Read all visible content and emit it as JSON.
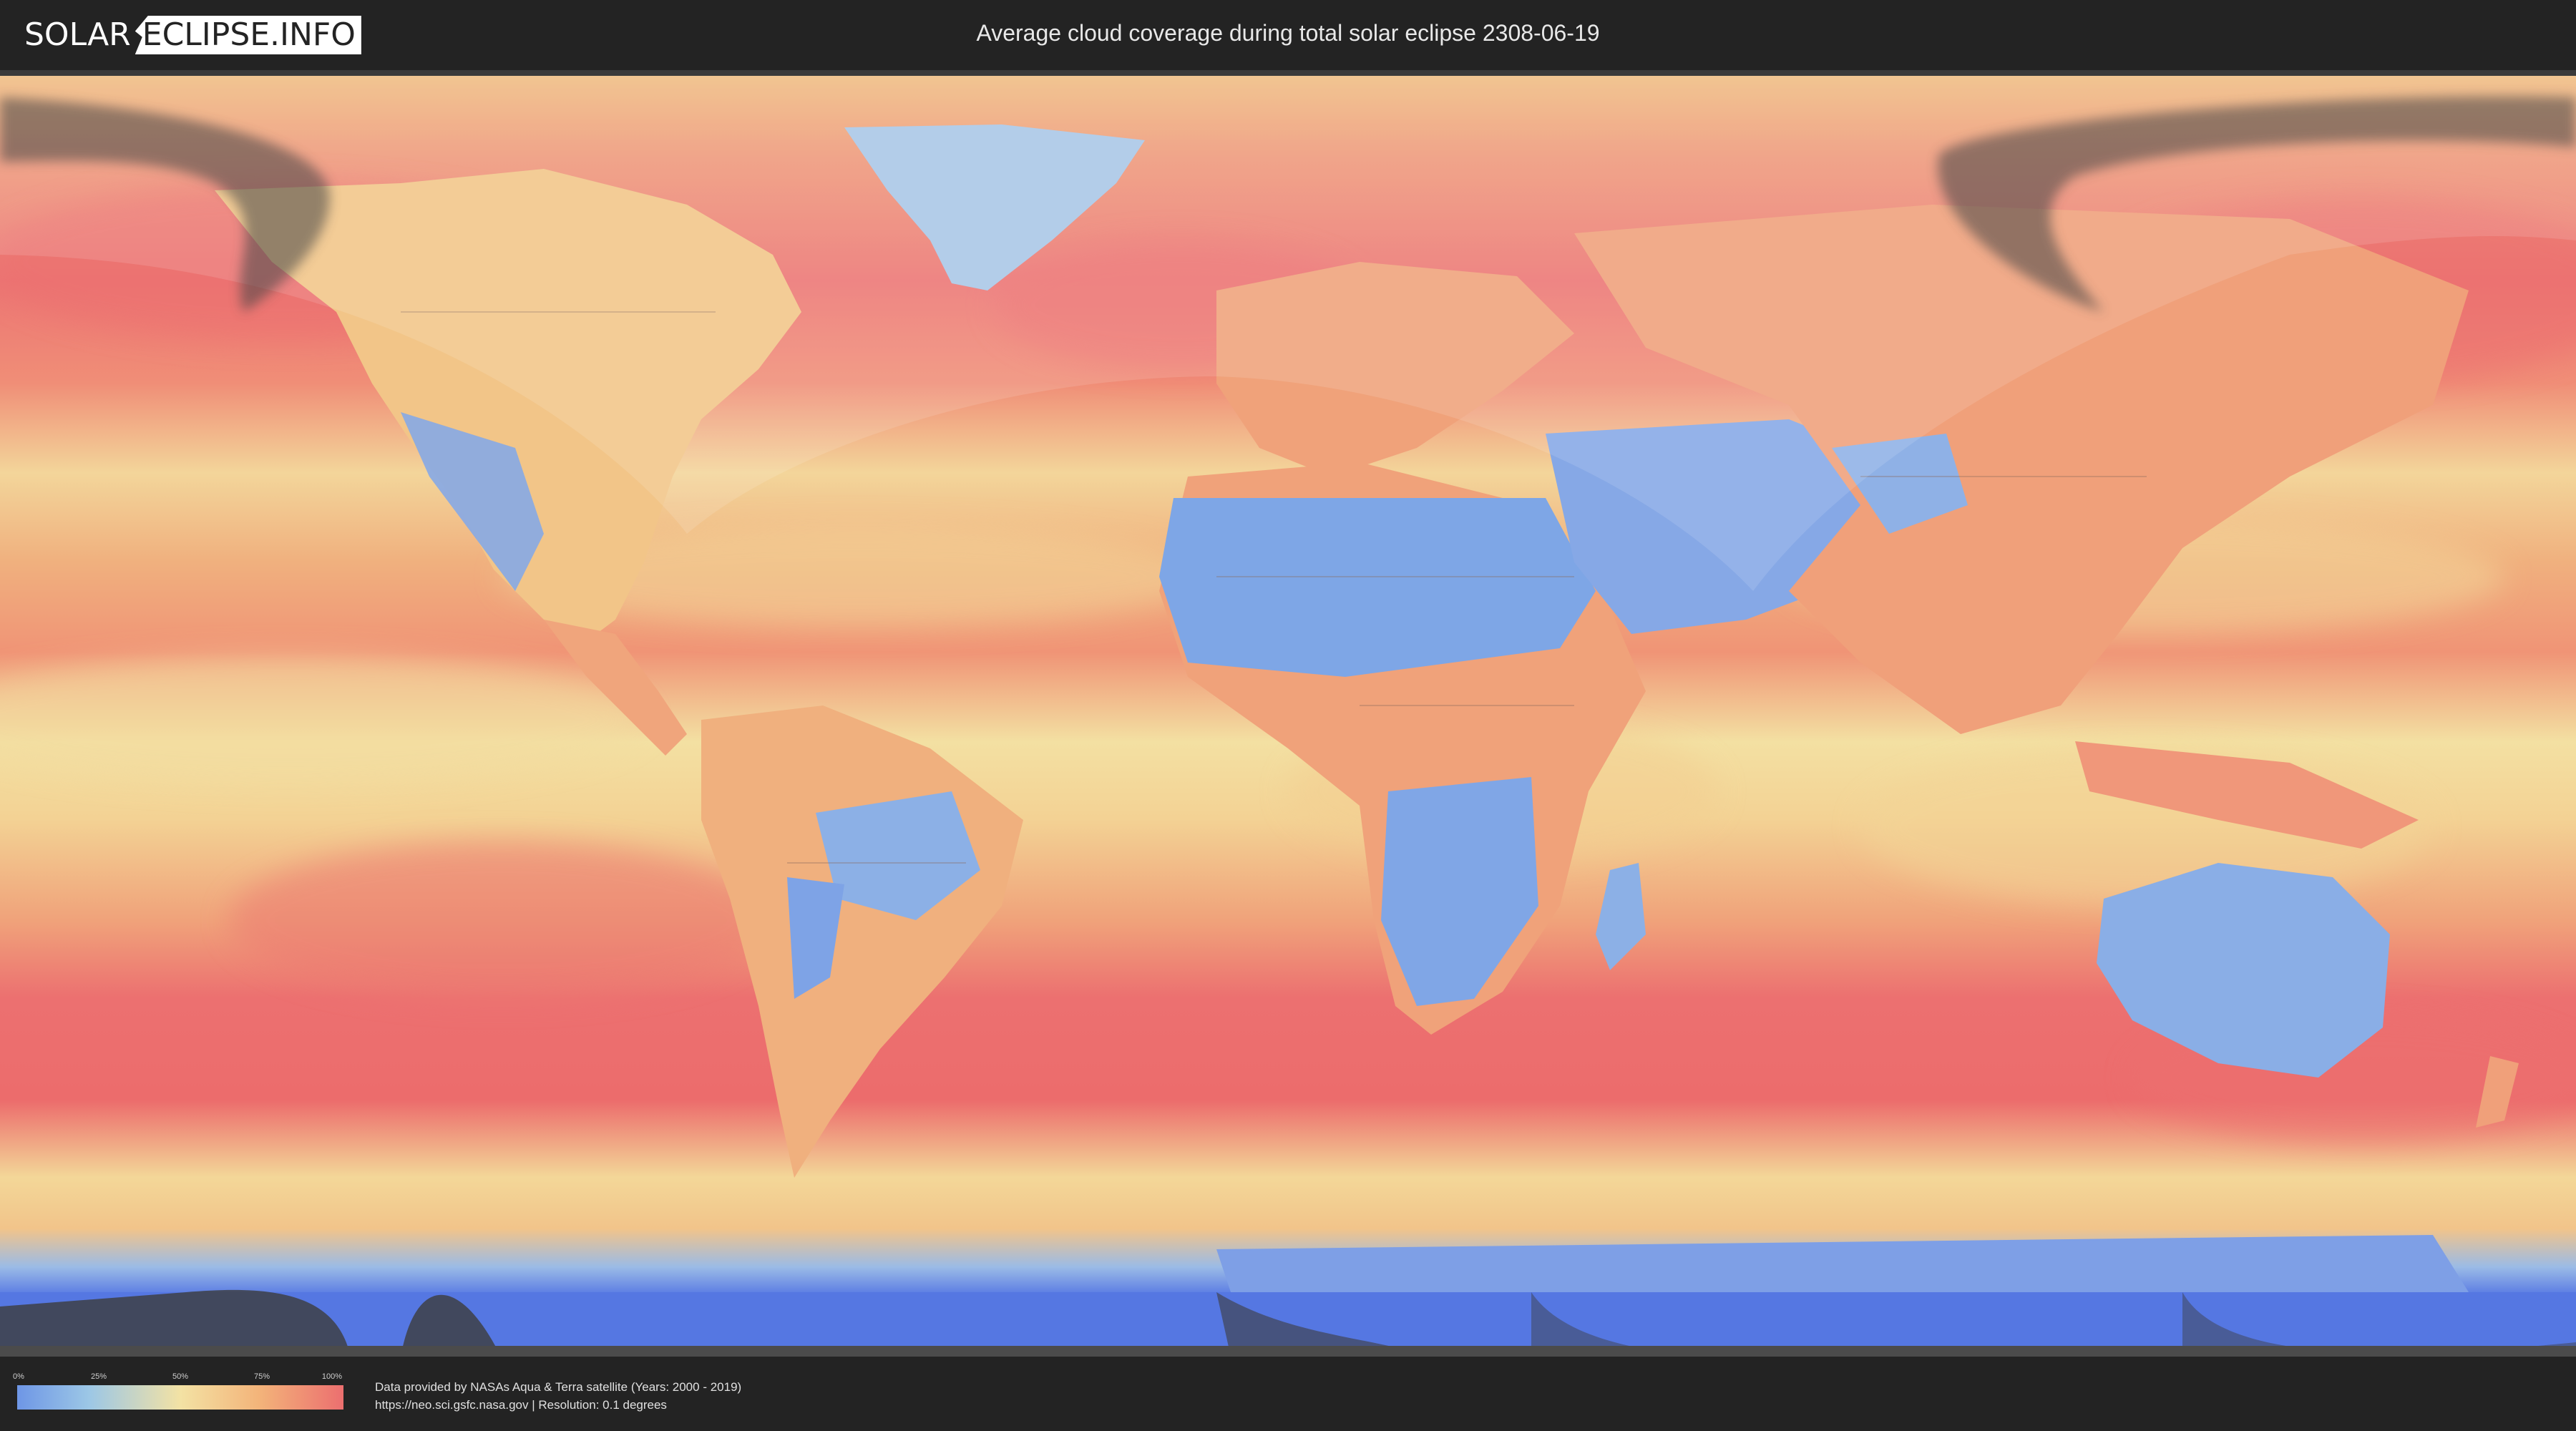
{
  "header": {
    "logo_left": "SOLAR",
    "logo_right": "ECLIPSE.INFO",
    "title": "Average cloud coverage during total solar eclipse 2308-06-19"
  },
  "map": {
    "colors": {
      "cloud_high": "#ec6f6f",
      "cloud_mid": "#f3c387",
      "cloud_low": "#f3e2a4",
      "clear": "#7ea6e6",
      "ice": "#5a7ee6",
      "eclipse_shadow": "#555555"
    }
  },
  "legend": {
    "ticks": [
      "0%",
      "25%",
      "50%",
      "75%",
      "100%"
    ]
  },
  "footer": {
    "attribution_line1": "Data provided by NASAs Aqua & Terra satellite (Years: 2000 - 2019)",
    "attribution_line2": "https://neo.sci.gsfc.nasa.gov | Resolution: 0.1 degrees"
  }
}
